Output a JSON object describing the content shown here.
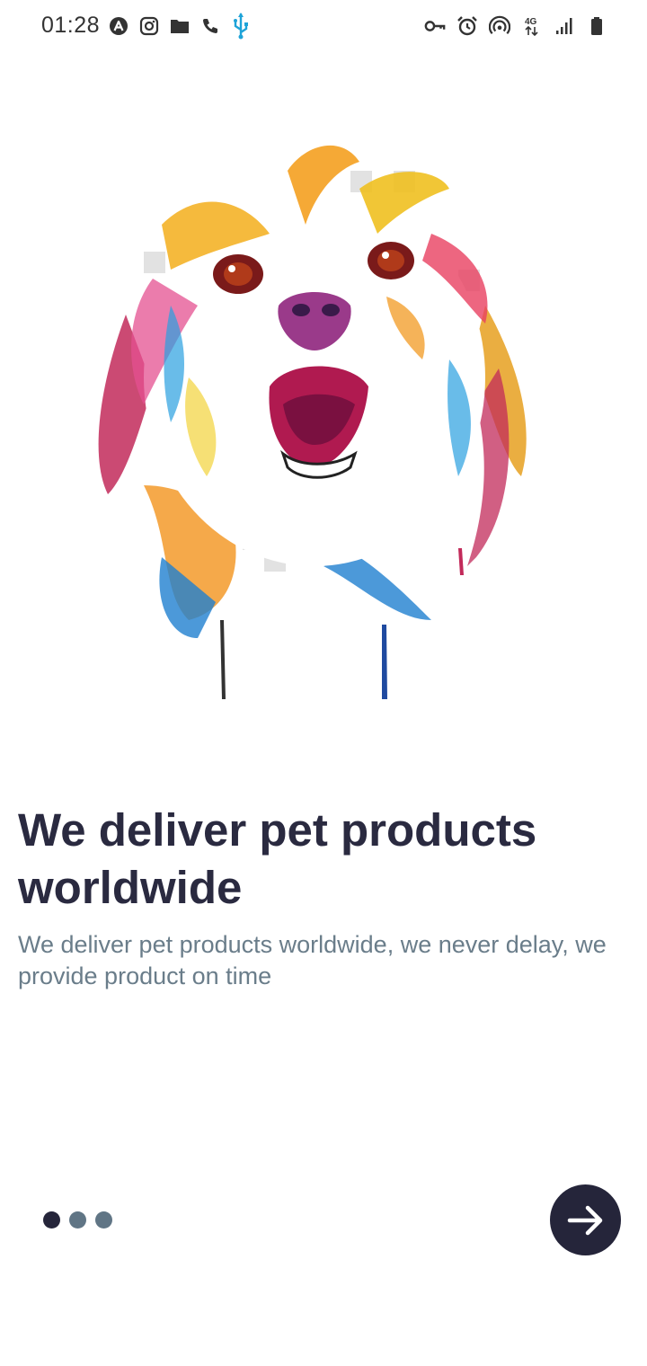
{
  "status_bar": {
    "time": "01:28",
    "left_icons": [
      "app-a-icon",
      "instagram-icon",
      "folder-icon",
      "phone-icon",
      "usb-icon"
    ],
    "right_icons": [
      "vpn-key-icon",
      "alarm-icon",
      "hotspot-icon",
      "network-4g-icon",
      "signal-icon",
      "battery-icon"
    ],
    "usb_color": "#1ea3d8"
  },
  "onboarding": {
    "hero_image": "colorful-dog-illustration",
    "title": "We deliver pet products worldwide",
    "description": "We deliver pet products worldwide, we never delay, we provide product on time",
    "page_indicator": {
      "total": 3,
      "current": 1
    },
    "next_button_icon": "arrow-right-icon"
  },
  "colors": {
    "primary": "#25253a",
    "secondary_text": "#6a7d8a",
    "inactive_dot": "#607585"
  }
}
